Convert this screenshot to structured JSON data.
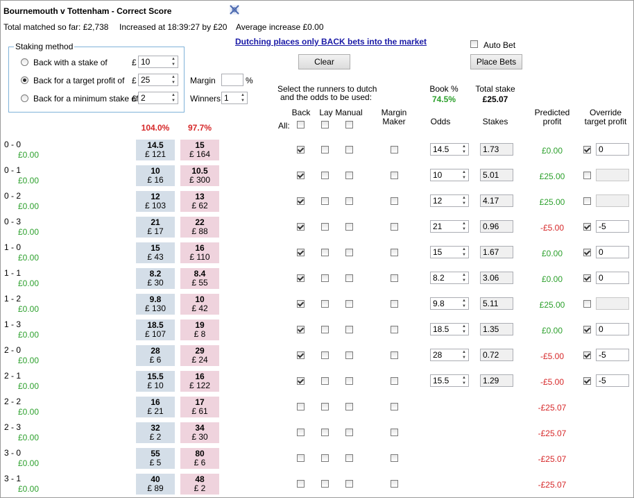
{
  "header": {
    "title": "Bournemouth v Tottenham - Correct Score",
    "total_matched": "Total matched so far: £2,738",
    "increased_at": "Increased at 18:39:27 by £20",
    "average_increase": "Average increase £0.00",
    "dutching_note": "Dutching places only BACK bets into the market"
  },
  "staking": {
    "legend": "Staking method",
    "options": [
      {
        "label": "Back with a stake of",
        "currency": "£",
        "value": "10",
        "selected": false
      },
      {
        "label": "Back for a target profit of",
        "currency": "£",
        "value": "25",
        "selected": true
      },
      {
        "label": "Back for a minimum stake of",
        "currency": "£",
        "value": "2",
        "selected": false
      }
    ],
    "margin_label": "Margin",
    "margin_value": "",
    "margin_unit": "%",
    "winners_label": "Winners",
    "winners_value": "1"
  },
  "controls": {
    "clear_label": "Clear",
    "auto_bet_label": "Auto Bet",
    "place_bets_label": "Place Bets"
  },
  "summary": {
    "instruction_line1": "Select the runners to dutch",
    "instruction_line2": "and the odds to be used:",
    "book_label": "Book %",
    "book_value": "74.5%",
    "total_stake_label": "Total stake",
    "total_stake_value": "£25.07",
    "back_book": "104.0%",
    "lay_book": "97.7%"
  },
  "columns": {
    "all": "All:",
    "back": "Back",
    "lay": "Lay",
    "manual": "Manual",
    "margin_maker_1": "Margin",
    "margin_maker_2": "Maker",
    "odds": "Odds",
    "stakes": "Stakes",
    "predicted_1": "Predicted",
    "predicted_2": "profit",
    "override_1": "Override",
    "override_2": "target profit"
  },
  "runners": [
    {
      "name": "0 - 0",
      "pl": "£0.00",
      "back_price": "14.5",
      "back_amt": "£ 121",
      "lay_price": "15",
      "lay_amt": "£ 164",
      "back_checked": true,
      "odds": "14.5",
      "stake": "1.73",
      "profit": "£0.00",
      "profit_color": "green",
      "override_checked": true,
      "override_value": "0",
      "override_enabled": true
    },
    {
      "name": "0 - 1",
      "pl": "£0.00",
      "back_price": "10",
      "back_amt": "£ 16",
      "lay_price": "10.5",
      "lay_amt": "£ 300",
      "back_checked": true,
      "odds": "10",
      "stake": "5.01",
      "profit": "£25.00",
      "profit_color": "green",
      "override_checked": false,
      "override_value": "",
      "override_enabled": false
    },
    {
      "name": "0 - 2",
      "pl": "£0.00",
      "back_price": "12",
      "back_amt": "£ 103",
      "lay_price": "13",
      "lay_amt": "£ 62",
      "back_checked": true,
      "odds": "12",
      "stake": "4.17",
      "profit": "£25.00",
      "profit_color": "green",
      "override_checked": false,
      "override_value": "",
      "override_enabled": false
    },
    {
      "name": "0 - 3",
      "pl": "£0.00",
      "back_price": "21",
      "back_amt": "£ 17",
      "lay_price": "22",
      "lay_amt": "£ 88",
      "back_checked": true,
      "odds": "21",
      "stake": "0.96",
      "profit": "-£5.00",
      "profit_color": "red",
      "override_checked": true,
      "override_value": "-5",
      "override_enabled": true
    },
    {
      "name": "1 - 0",
      "pl": "£0.00",
      "back_price": "15",
      "back_amt": "£ 43",
      "lay_price": "16",
      "lay_amt": "£ 110",
      "back_checked": true,
      "odds": "15",
      "stake": "1.67",
      "profit": "£0.00",
      "profit_color": "green",
      "override_checked": true,
      "override_value": "0",
      "override_enabled": true
    },
    {
      "name": "1 - 1",
      "pl": "£0.00",
      "back_price": "8.2",
      "back_amt": "£ 30",
      "lay_price": "8.4",
      "lay_amt": "£ 55",
      "back_checked": true,
      "odds": "8.2",
      "stake": "3.06",
      "profit": "£0.00",
      "profit_color": "green",
      "override_checked": true,
      "override_value": "0",
      "override_enabled": true
    },
    {
      "name": "1 - 2",
      "pl": "£0.00",
      "back_price": "9.8",
      "back_amt": "£ 130",
      "lay_price": "10",
      "lay_amt": "£ 42",
      "back_checked": true,
      "odds": "9.8",
      "stake": "5.11",
      "profit": "£25.00",
      "profit_color": "green",
      "override_checked": false,
      "override_value": "",
      "override_enabled": false
    },
    {
      "name": "1 - 3",
      "pl": "£0.00",
      "back_price": "18.5",
      "back_amt": "£ 107",
      "lay_price": "19",
      "lay_amt": "£ 8",
      "back_checked": true,
      "odds": "18.5",
      "stake": "1.35",
      "profit": "£0.00",
      "profit_color": "green",
      "override_checked": true,
      "override_value": "0",
      "override_enabled": true
    },
    {
      "name": "2 - 0",
      "pl": "£0.00",
      "back_price": "28",
      "back_amt": "£ 6",
      "lay_price": "29",
      "lay_amt": "£ 24",
      "back_checked": true,
      "odds": "28",
      "stake": "0.72",
      "profit": "-£5.00",
      "profit_color": "red",
      "override_checked": true,
      "override_value": "-5",
      "override_enabled": true
    },
    {
      "name": "2 - 1",
      "pl": "£0.00",
      "back_price": "15.5",
      "back_amt": "£ 10",
      "lay_price": "16",
      "lay_amt": "£ 122",
      "back_checked": true,
      "odds": "15.5",
      "stake": "1.29",
      "profit": "-£5.00",
      "profit_color": "red",
      "override_checked": true,
      "override_value": "-5",
      "override_enabled": true
    },
    {
      "name": "2 - 2",
      "pl": "£0.00",
      "back_price": "16",
      "back_amt": "£ 21",
      "lay_price": "17",
      "lay_amt": "£ 61",
      "back_checked": false,
      "odds": "",
      "stake": "",
      "profit": "-£25.07",
      "profit_color": "red",
      "override_checked": false,
      "override_value": "",
      "override_enabled": null
    },
    {
      "name": "2 - 3",
      "pl": "£0.00",
      "back_price": "32",
      "back_amt": "£ 2",
      "lay_price": "34",
      "lay_amt": "£ 30",
      "back_checked": false,
      "odds": "",
      "stake": "",
      "profit": "-£25.07",
      "profit_color": "red",
      "override_checked": false,
      "override_value": "",
      "override_enabled": null
    },
    {
      "name": "3 - 0",
      "pl": "£0.00",
      "back_price": "55",
      "back_amt": "£ 5",
      "lay_price": "80",
      "lay_amt": "£ 6",
      "back_checked": false,
      "odds": "",
      "stake": "",
      "profit": "-£25.07",
      "profit_color": "red",
      "override_checked": false,
      "override_value": "",
      "override_enabled": null
    },
    {
      "name": "3 - 1",
      "pl": "£0.00",
      "back_price": "40",
      "back_amt": "£ 89",
      "lay_price": "48",
      "lay_amt": "£ 2",
      "back_checked": false,
      "odds": "",
      "stake": "",
      "profit": "-£25.07",
      "profit_color": "red",
      "override_checked": false,
      "override_value": "",
      "override_enabled": null
    }
  ]
}
